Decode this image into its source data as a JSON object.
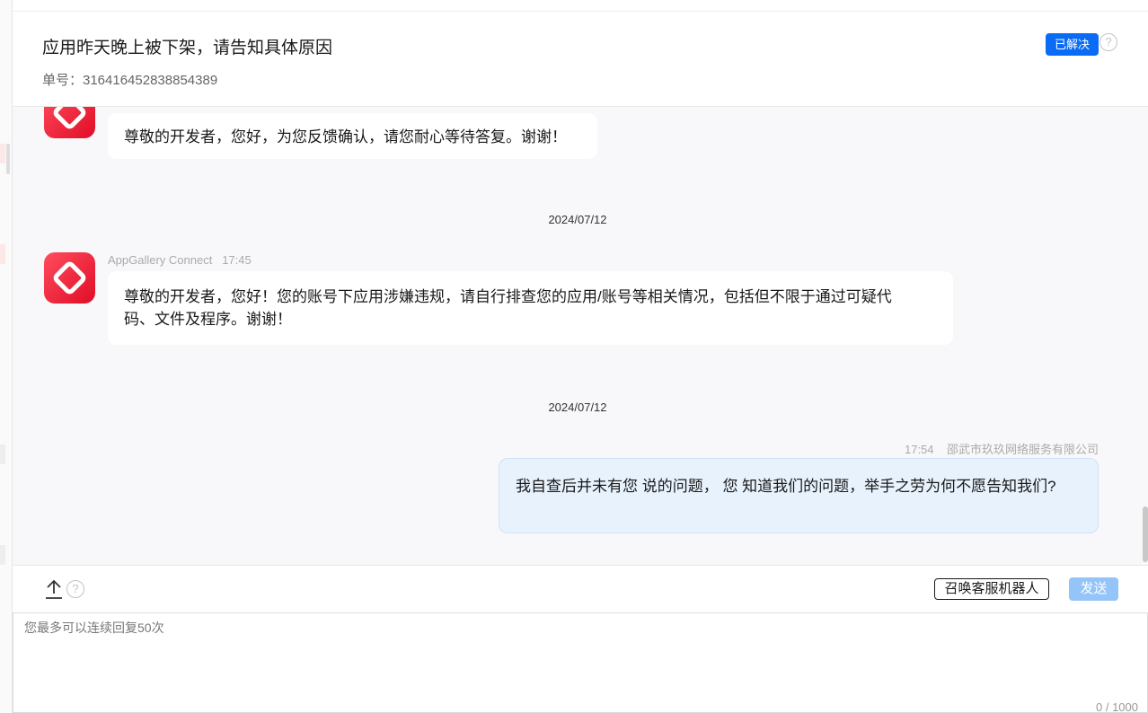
{
  "header": {
    "title": "应用昨天晚上被下架，请告知具体原因",
    "ticket_label": "单号：316416452838854389",
    "resolved_button": "已解决",
    "help_icon": "?"
  },
  "messages": [
    {
      "sender": "",
      "time": "",
      "text": "尊敬的开发者，您好，为您反馈确认，请您耐心等待答复。谢谢！"
    },
    {
      "date": "2024/07/12"
    },
    {
      "sender": "AppGallery Connect",
      "time": "17:45",
      "text_line1": "尊敬的开发者，您好！您的账号下应用涉嫌违规，请自行排查您的应用/账号等相关情况，包括但不限于通过可疑代",
      "text_line2": "码、文件及程序。谢谢！"
    },
    {
      "date": "2024/07/12"
    },
    {
      "sender": "邵武市玖玖网络服务有限公司",
      "time": "17:54",
      "text": "我自查后并未有您 说的问题， 您 知道我们的问题，举手之劳为何不愿告知我们?"
    }
  ],
  "toolbar": {
    "help_icon": "?",
    "robot_button": "召唤客服机器人",
    "send_button": "发送"
  },
  "input": {
    "placeholder": "您最多可以连续回复50次",
    "counter": "0 / 1000"
  },
  "colors": {
    "accent": "#0a6cf5",
    "send_disabled": "#94c4f8",
    "avatar": "#ee1b31"
  }
}
